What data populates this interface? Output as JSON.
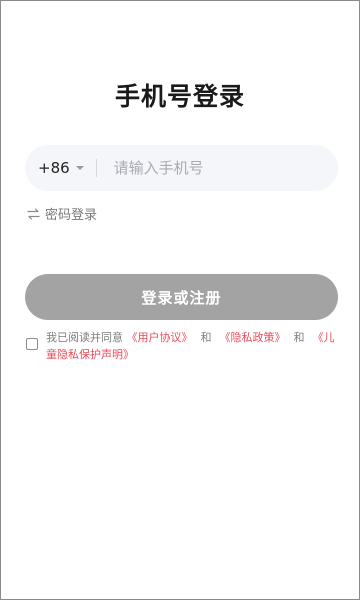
{
  "page": {
    "title": "手机号登录"
  },
  "phone": {
    "country_code": "+86",
    "placeholder": "请输入手机号",
    "value": ""
  },
  "switch_login": {
    "label": "密码登录"
  },
  "submit": {
    "label": "登录或注册",
    "color": "#a3a3a3"
  },
  "agreement": {
    "prefix": "我已阅读并同意",
    "user_agreement": "《用户协议》",
    "and1": "和",
    "privacy_policy": "《隐私政策》",
    "and2": "和",
    "child_privacy": "《儿童隐私保护声明》",
    "link_color": "#e84c5a",
    "checked": false
  }
}
